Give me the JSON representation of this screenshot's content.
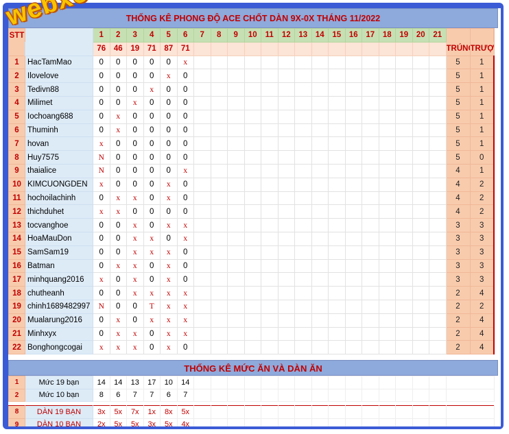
{
  "title": "THỐNG KÊ PHONG ĐỘ ACE CHỐT DÀN 9X-0X THÁNG 11/2022",
  "watermark": "webxoso.net",
  "header": {
    "stt": "STT",
    "trung": "TRÚNG",
    "truot": "TRƯỢT",
    "days": [
      "1",
      "2",
      "3",
      "4",
      "5",
      "6",
      "7",
      "8",
      "9",
      "10",
      "11",
      "12",
      "13",
      "14",
      "15",
      "16",
      "17",
      "18",
      "19",
      "20",
      "21"
    ],
    "day_values": [
      "76",
      "46",
      "19",
      "71",
      "87",
      "71"
    ]
  },
  "rows": [
    {
      "stt": "1",
      "name": "HacTamMao",
      "cells": [
        "0",
        "0",
        "0",
        "0",
        "0",
        "x"
      ],
      "trung": "5",
      "truot": "1"
    },
    {
      "stt": "2",
      "name": "Ilovelove",
      "cells": [
        "0",
        "0",
        "0",
        "0",
        "x",
        "0"
      ],
      "trung": "5",
      "truot": "1"
    },
    {
      "stt": "3",
      "name": "Tedivn88",
      "cells": [
        "0",
        "0",
        "0",
        "x",
        "0",
        "0"
      ],
      "trung": "5",
      "truot": "1"
    },
    {
      "stt": "4",
      "name": "Milimet",
      "cells": [
        "0",
        "0",
        "x",
        "0",
        "0",
        "0"
      ],
      "trung": "5",
      "truot": "1"
    },
    {
      "stt": "5",
      "name": "Iochoang688",
      "cells": [
        "0",
        "x",
        "0",
        "0",
        "0",
        "0"
      ],
      "trung": "5",
      "truot": "1"
    },
    {
      "stt": "6",
      "name": "Thuminh",
      "cells": [
        "0",
        "x",
        "0",
        "0",
        "0",
        "0"
      ],
      "trung": "5",
      "truot": "1"
    },
    {
      "stt": "7",
      "name": "hovan",
      "cells": [
        "x",
        "0",
        "0",
        "0",
        "0",
        "0"
      ],
      "trung": "5",
      "truot": "1"
    },
    {
      "stt": "8",
      "name": "Huy7575",
      "cells": [
        "N",
        "0",
        "0",
        "0",
        "0",
        "0"
      ],
      "trung": "5",
      "truot": "0"
    },
    {
      "stt": "9",
      "name": "thaialice",
      "cells": [
        "N",
        "0",
        "0",
        "0",
        "0",
        "x"
      ],
      "trung": "4",
      "truot": "1"
    },
    {
      "stt": "10",
      "name": "KIMCUONGDEN",
      "cells": [
        "x",
        "0",
        "0",
        "0",
        "x",
        "0"
      ],
      "trung": "4",
      "truot": "2"
    },
    {
      "stt": "11",
      "name": "hochoilachinh",
      "cells": [
        "0",
        "x",
        "x",
        "0",
        "x",
        "0"
      ],
      "trung": "4",
      "truot": "2"
    },
    {
      "stt": "12",
      "name": "thichduhet",
      "cells": [
        "x",
        "x",
        "0",
        "0",
        "0",
        "0"
      ],
      "trung": "4",
      "truot": "2"
    },
    {
      "stt": "13",
      "name": "tocvanghoe",
      "cells": [
        "0",
        "0",
        "x",
        "0",
        "x",
        "x"
      ],
      "trung": "3",
      "truot": "3"
    },
    {
      "stt": "14",
      "name": "HoaMauDon",
      "cells": [
        "0",
        "0",
        "x",
        "x",
        "0",
        "x"
      ],
      "trung": "3",
      "truot": "3"
    },
    {
      "stt": "15",
      "name": "SamSam19",
      "cells": [
        "0",
        "0",
        "x",
        "x",
        "x",
        "0"
      ],
      "trung": "3",
      "truot": "3"
    },
    {
      "stt": "16",
      "name": "Batman",
      "cells": [
        "0",
        "x",
        "x",
        "0",
        "x",
        "0"
      ],
      "trung": "3",
      "truot": "3"
    },
    {
      "stt": "17",
      "name": "minhquang2016",
      "cells": [
        "x",
        "0",
        "x",
        "0",
        "x",
        "0"
      ],
      "trung": "3",
      "truot": "3"
    },
    {
      "stt": "18",
      "name": "chutheanh",
      "cells": [
        "0",
        "0",
        "x",
        "x",
        "x",
        "x"
      ],
      "trung": "2",
      "truot": "4"
    },
    {
      "stt": "19",
      "name": "chinh1689482997",
      "cells": [
        "N",
        "0",
        "0",
        "T",
        "x",
        "x"
      ],
      "trung": "2",
      "truot": "2"
    },
    {
      "stt": "20",
      "name": "Mualarung2016",
      "cells": [
        "0",
        "x",
        "0",
        "x",
        "x",
        "x"
      ],
      "trung": "2",
      "truot": "4"
    },
    {
      "stt": "21",
      "name": "Minhxyx",
      "cells": [
        "0",
        "x",
        "x",
        "0",
        "x",
        "x"
      ],
      "trung": "2",
      "truot": "4"
    },
    {
      "stt": "22",
      "name": "Bonghongcogai",
      "cells": [
        "x",
        "x",
        "x",
        "0",
        "x",
        "0"
      ],
      "trung": "2",
      "truot": "4"
    }
  ],
  "stats_title": "THỐNG KÊ MỨC ĂN VÀ DÀN ĂN",
  "stats": [
    {
      "stt": "1",
      "label": "Mức 19 bạn",
      "values": [
        "14",
        "14",
        "13",
        "17",
        "10",
        "14"
      ],
      "style": "black"
    },
    {
      "stt": "2",
      "label": "Mức 10 bạn",
      "values": [
        "8",
        "6",
        "7",
        "7",
        "6",
        "7"
      ],
      "style": "black"
    },
    {
      "stt": "8",
      "label": "DÀN 19 BẠN",
      "values": [
        "3x",
        "5x",
        "7x",
        "1x",
        "8x",
        "5x"
      ],
      "style": "red"
    },
    {
      "stt": "9",
      "label": "DÀN 10 BẠN",
      "values": [
        "2x",
        "5x",
        "5x",
        "3x",
        "5x",
        "4x"
      ],
      "style": "red"
    }
  ],
  "colors": {
    "frame": "#3b5bd6",
    "title_bg": "#8ea9db",
    "accent_red": "#c00000",
    "name_bg": "#ddebf7",
    "stt_bg": "#f8cbad",
    "day_bg": "#c6e0b4"
  }
}
